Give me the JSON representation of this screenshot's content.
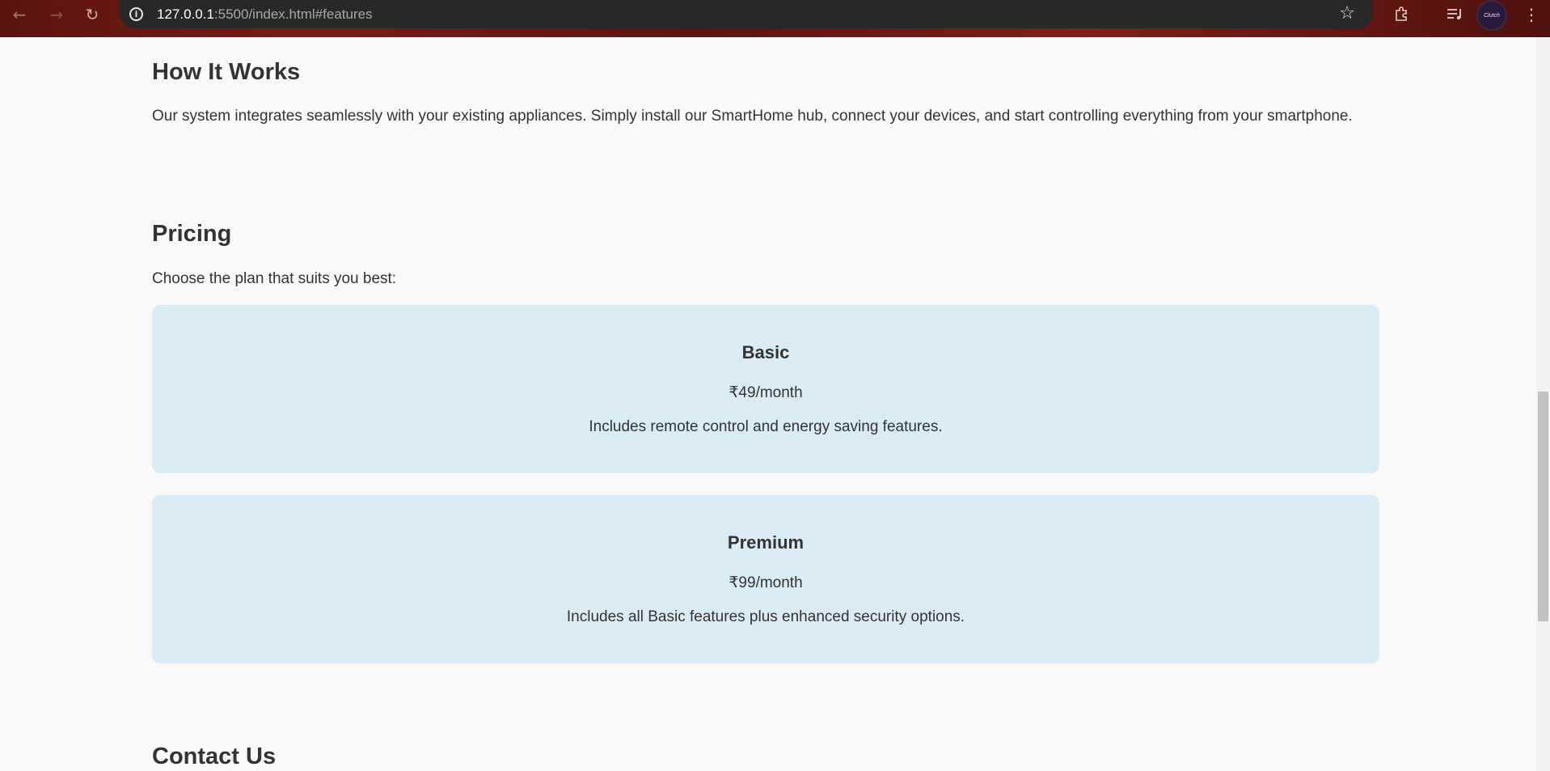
{
  "browser": {
    "url_host": "127.0.0.1",
    "url_rest": ":5500/index.html#features",
    "avatar_text": "Clutch"
  },
  "how_it_works": {
    "title": "How It Works",
    "text": "Our system integrates seamlessly with your existing appliances. Simply install our SmartHome hub, connect your devices, and start controlling everything from your smartphone."
  },
  "pricing": {
    "title": "Pricing",
    "intro": "Choose the plan that suits you best:",
    "plans": [
      {
        "name": "Basic",
        "price": "₹49/month",
        "description": "Includes remote control and energy saving features."
      },
      {
        "name": "Premium",
        "price": "₹99/month",
        "description": "Includes all Basic features plus enhanced security options."
      }
    ]
  },
  "contact": {
    "title": "Contact Us"
  },
  "colors": {
    "page_background": "#f9f9f9",
    "card_background": "#d9ecf6",
    "text": "#333333"
  }
}
